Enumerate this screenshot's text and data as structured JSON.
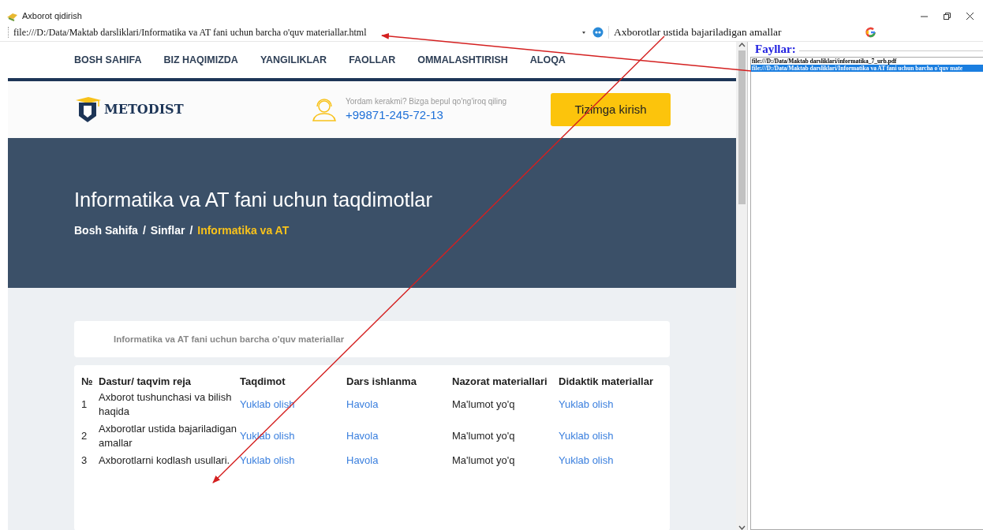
{
  "window": {
    "title": "Axborot qidirish"
  },
  "address_bar": {
    "url": "file:///D:/Data/Maktab darsliklari/Informatika va AT fani uchun barcha o'quv materiallar.html",
    "query": "Axborotlar ustida bajariladigan amallar"
  },
  "site": {
    "nav": [
      "BOSH SAHIFA",
      "BIZ HAQIMIZDA",
      "YANGILIKLAR",
      "FAOLLAR",
      "OMMALASHTIRISH",
      "ALOQA"
    ],
    "logo": "METODIST",
    "help_text": "Yordam kerakmi? Bizga bepul qo'ng'iroq qiling",
    "phone": "+99871-245-72-13",
    "login_button": "Tizimga kirish",
    "hero_title": "Informatika va AT fani uchun taqdimotlar",
    "breadcrumb": [
      {
        "label": "Bosh Sahifa",
        "current": false
      },
      {
        "label": "Sinflar",
        "current": false
      },
      {
        "label": "Informatika va AT",
        "current": true
      }
    ],
    "breadcrumb_separator": "/",
    "card_title": "Informatika va AT fani uchun barcha o'quv materiallar",
    "table": {
      "columns": [
        "№",
        "Dastur/ taqvim reja",
        "Taqdimot",
        "Dars ishlanma",
        "Nazorat materiallari",
        "Didaktik materiallar"
      ],
      "rows": [
        {
          "cells": [
            "1",
            "Axborot tushunchasi va bilish haqida",
            "Yuklab olish",
            "Havola",
            "Ma'lumot yo'q",
            "Yuklab olish"
          ]
        },
        {
          "cells": [
            "2",
            "Axborotlar ustida bajariladigan amallar",
            "Yuklab olish",
            "Havola",
            "Ma'lumot yo'q",
            "Yuklab olish"
          ]
        },
        {
          "cells": [
            "3",
            "Axborotlarni kodlash usullari.",
            "Yuklab olish",
            "Havola",
            "Ma'lumot yo'q",
            "Yuklab olish"
          ]
        }
      ]
    }
  },
  "files_panel": {
    "title": "Fayllar:",
    "items": [
      {
        "label": "file:///D:/Data/Maktab darsliklari/informatika_7_urb.pdf",
        "selected": false
      },
      {
        "label": "file:///D:/Data/Maktab darsliklari/Informatika va AT fani uchun barcha o'quv mate",
        "selected": true
      }
    ]
  }
}
